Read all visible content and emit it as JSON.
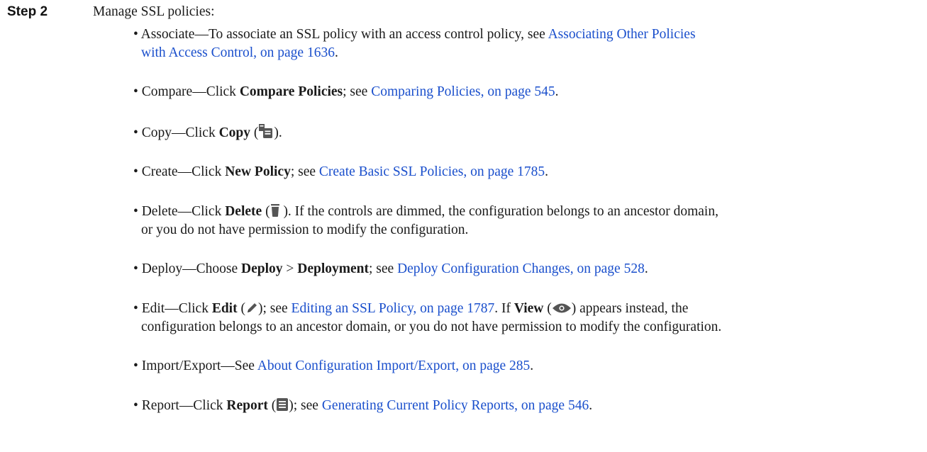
{
  "step": {
    "label": "Step 2",
    "intro": "Manage SSL policies:"
  },
  "items": {
    "associate": {
      "bullet": "•",
      "term": "Associate",
      "text1": "—To associate an SSL policy with an access control policy, see ",
      "link1": "Associating Other Policies",
      "link2": "with Access Control, on page 1636",
      "end": "."
    },
    "compare": {
      "bullet": "•",
      "term": "Compare",
      "pre": "—Click ",
      "bold": "Compare Policies",
      "mid": "; see ",
      "link": "Comparing Policies, on page 545",
      "end": "."
    },
    "copy": {
      "bullet": "•",
      "term": "Copy",
      "pre": "—Click ",
      "bold": "Copy",
      "open": " (",
      "close": ").",
      "icon": "copy-icon"
    },
    "create": {
      "bullet": "•",
      "term": "Create",
      "pre": "—Click ",
      "bold": "New Policy",
      "mid": "; see ",
      "link": "Create Basic SSL Policies, on page 1785",
      "end": "."
    },
    "delete": {
      "bullet": "•",
      "term": "Delete",
      "pre": "—Click ",
      "bold": "Delete",
      "open": " (",
      "icon": "delete-icon",
      "after": " ). If the controls are dimmed, the configuration belongs to an ancestor domain,",
      "line2": "or you do not have permission to modify the configuration."
    },
    "deploy": {
      "bullet": "•",
      "term": "Deploy",
      "pre": "—Choose ",
      "bold1": "Deploy",
      "sep": " > ",
      "bold2": "Deployment",
      "mid": "; see ",
      "link": "Deploy Configuration Changes, on page 528",
      "end": "."
    },
    "edit": {
      "bullet": "•",
      "term": "Edit",
      "pre": "—Click ",
      "bold": "Edit",
      "open": " (",
      "icon": "pencil-icon",
      "mid": "); see ",
      "link": "Editing an SSL Policy, on page 1787",
      "mid2": ". If ",
      "bold2": "View",
      "open2": " (",
      "icon2": "eye-icon",
      "after": ") appears instead, the",
      "line2": "configuration belongs to an ancestor domain, or you do not have permission to modify the configuration."
    },
    "importexport": {
      "bullet": "•",
      "term": "Import/Export",
      "pre": "—See ",
      "link": "About Configuration Import/Export, on page 285",
      "end": "."
    },
    "report": {
      "bullet": "•",
      "term": "Report",
      "pre": "—Click ",
      "bold": "Report",
      "open": " (",
      "icon": "report-icon",
      "mid": "); see ",
      "link": "Generating Current Policy Reports, on page 546",
      "end": "."
    }
  }
}
